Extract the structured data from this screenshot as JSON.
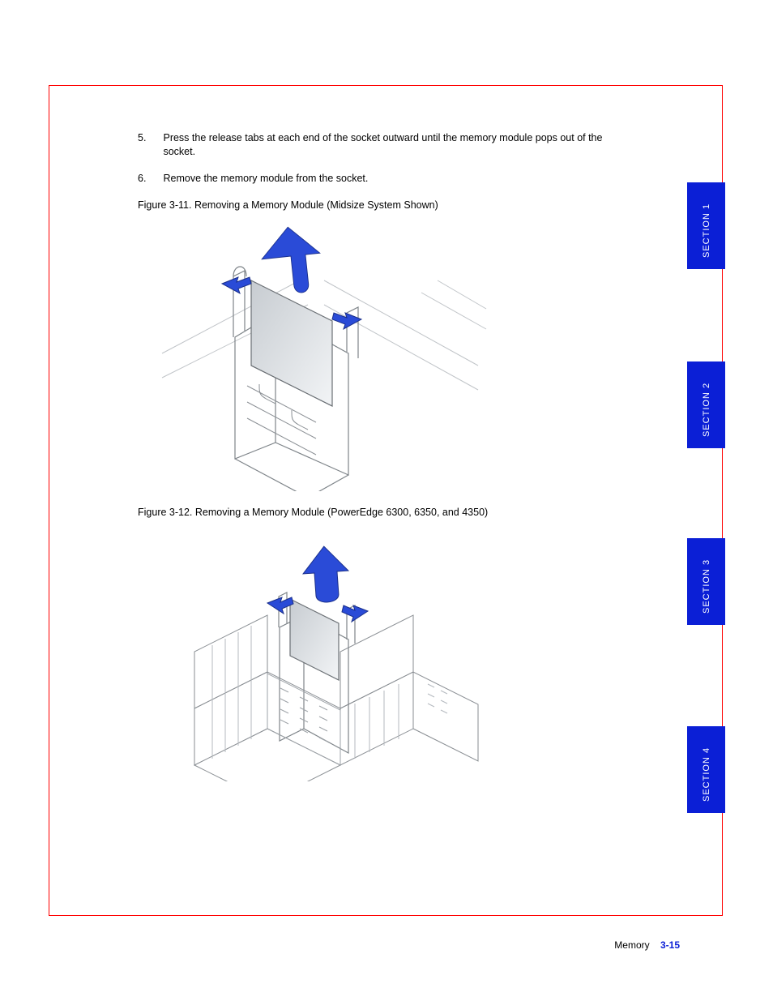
{
  "steps": {
    "s5_num": "5.",
    "s5_txt": "Press the release tabs at each end of the socket outward until the memory module pops out of the socket.",
    "s6_num": "6.",
    "s6_txt": "Remove the memory module from the socket."
  },
  "figures": {
    "cap1": "Figure 3-11.  Removing a Memory Module (Midsize System Shown)",
    "cap2": "Figure 3-12.  Removing a Memory Module (PowerEdge 6300, 6350, and 4350)"
  },
  "tabs": {
    "t1": "SECTION 1",
    "t2": "SECTION 2",
    "t3": "SECTION 3",
    "t4": "SECTION 4"
  },
  "footer": {
    "prefix": "Memory",
    "page": "3-15"
  }
}
